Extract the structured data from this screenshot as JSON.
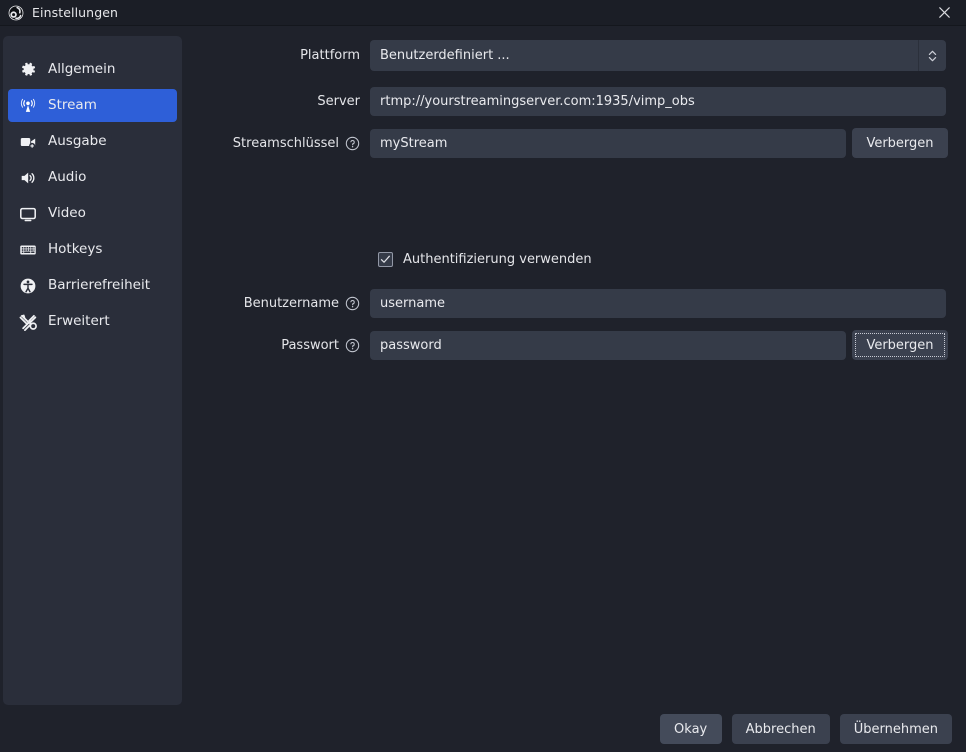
{
  "window": {
    "title": "Einstellungen",
    "logo_icon": "obs-logo-icon",
    "close_icon": "close-icon"
  },
  "sidebar": {
    "items": [
      {
        "label": "Allgemein",
        "icon": "gear-icon",
        "selected": false
      },
      {
        "label": "Stream",
        "icon": "broadcast-icon",
        "selected": true
      },
      {
        "label": "Ausgabe",
        "icon": "video-camera-icon",
        "selected": false
      },
      {
        "label": "Audio",
        "icon": "speaker-icon",
        "selected": false
      },
      {
        "label": "Video",
        "icon": "monitor-icon",
        "selected": false
      },
      {
        "label": "Hotkeys",
        "icon": "keyboard-icon",
        "selected": false
      },
      {
        "label": "Barrierefreiheit",
        "icon": "accessibility-icon",
        "selected": false
      },
      {
        "label": "Erweitert",
        "icon": "tools-icon",
        "selected": false
      }
    ]
  },
  "stream": {
    "platform": {
      "label": "Plattform",
      "value": "Benutzerdefiniert ...",
      "spinner_icon": "chevron-up-down-icon"
    },
    "server": {
      "label": "Server",
      "value": "rtmp://yourstreamingserver.com:1935/vimp_obs"
    },
    "stream_key": {
      "label": "Streamschlüssel",
      "help_icon": "help-circle-icon",
      "value": "myStream",
      "toggle_label": "Verbergen"
    },
    "use_auth": {
      "label": "Authentifizierung verwenden",
      "checked": true,
      "check_icon": "checkmark-icon"
    },
    "username": {
      "label": "Benutzername",
      "help_icon": "help-circle-icon",
      "value": "username"
    },
    "password": {
      "label": "Passwort",
      "help_icon": "help-circle-icon",
      "value": "password",
      "toggle_label": "Verbergen"
    }
  },
  "footer": {
    "ok_label": "Okay",
    "cancel_label": "Abbrechen",
    "apply_label": "Übernehmen"
  },
  "colors": {
    "window_bg": "#1f222b",
    "titlebar_bg": "#1b1e26",
    "sidebar_bg": "#2a2e3a",
    "accent": "#2e5fd8",
    "field_bg": "#353b48",
    "button_bg": "#3b414f",
    "text": "#e8e9ec"
  }
}
